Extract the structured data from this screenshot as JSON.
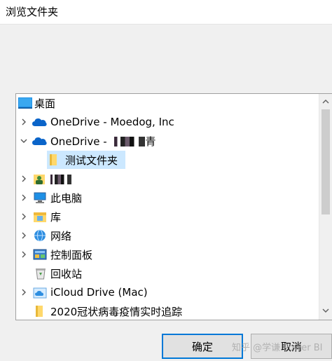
{
  "window": {
    "title": "浏览文件夹"
  },
  "tree": {
    "items": [
      {
        "label": "桌面",
        "icon": "desktop-icon",
        "expander": "none",
        "selected": false
      },
      {
        "label": "OneDrive - Moedog, Inc",
        "icon": "onedrive-cloud-icon",
        "expander": "collapsed",
        "selected": false
      },
      {
        "label": "OneDrive - ",
        "icon": "onedrive-cloud-icon",
        "expander": "expanded",
        "selected": false,
        "label_suffix": "青"
      },
      {
        "label": "测试文件夹",
        "icon": "folder-icon",
        "expander": "none",
        "selected": true
      },
      {
        "label": "",
        "icon": "user-folder-icon",
        "expander": "collapsed",
        "selected": false
      },
      {
        "label": "此电脑",
        "icon": "computer-icon",
        "expander": "collapsed",
        "selected": false
      },
      {
        "label": "库",
        "icon": "library-icon",
        "expander": "collapsed",
        "selected": false
      },
      {
        "label": "网络",
        "icon": "network-icon",
        "expander": "collapsed",
        "selected": false
      },
      {
        "label": "控制面板",
        "icon": "control-panel-icon",
        "expander": "collapsed",
        "selected": false
      },
      {
        "label": "回收站",
        "icon": "recycle-bin-icon",
        "expander": "none",
        "selected": false
      },
      {
        "label": "iCloud Drive (Mac)",
        "icon": "icloud-folder-icon",
        "expander": "collapsed",
        "selected": false
      },
      {
        "label": "2020冠状病毒疫情实时追踪",
        "icon": "folder-icon",
        "expander": "none",
        "selected": false
      }
    ]
  },
  "buttons": {
    "ok": "确定",
    "cancel": "取消"
  },
  "watermark": "知乎 @学谦 Power BI",
  "colors": {
    "selection": "#cce8ff",
    "accent": "#0078d7",
    "onedrive": "#0a64c9",
    "folder": "#ffd86b"
  }
}
